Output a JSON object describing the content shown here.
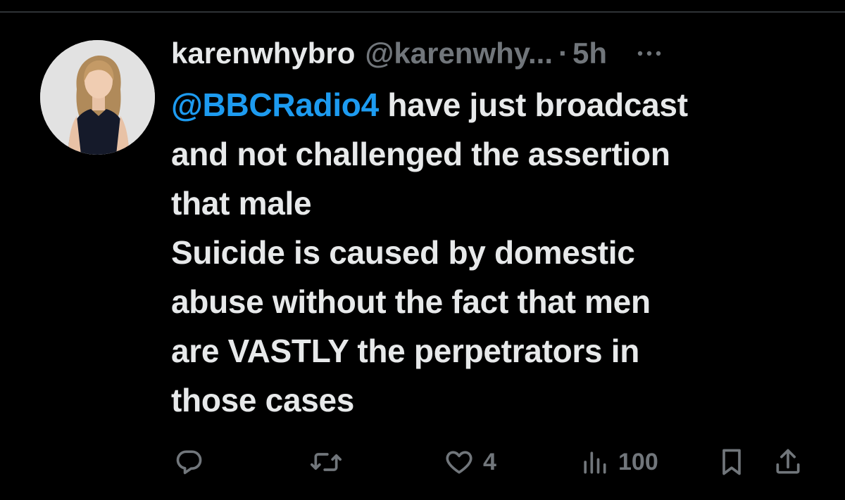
{
  "tweet": {
    "author": {
      "display_name": "karenwhybro",
      "handle": "@karenwhy...",
      "avatar_icon": "profile-photo"
    },
    "separator": "·",
    "time": "5h",
    "more_icon": "ellipsis-icon",
    "text": {
      "mention": "@BBCRadio4",
      "line1_rest": " have just broadcast",
      "line2": "and not challenged the assertion",
      "line3": "that male",
      "line4": "Suicide is caused by domestic",
      "line5": "abuse without the fact that men",
      "line6": "are VASTLY the perpetrators in",
      "line7": "those cases"
    },
    "actions": {
      "reply": {
        "icon": "reply-icon",
        "count": ""
      },
      "retweet": {
        "icon": "retweet-icon",
        "count": ""
      },
      "like": {
        "icon": "heart-icon",
        "count": "4"
      },
      "views": {
        "icon": "views-icon",
        "count": "100"
      },
      "bookmark": {
        "icon": "bookmark-icon"
      },
      "share": {
        "icon": "share-icon"
      }
    }
  },
  "colors": {
    "background": "#000000",
    "text": "#e7e9ea",
    "muted": "#71767b",
    "mention": "#1d9bf0"
  }
}
